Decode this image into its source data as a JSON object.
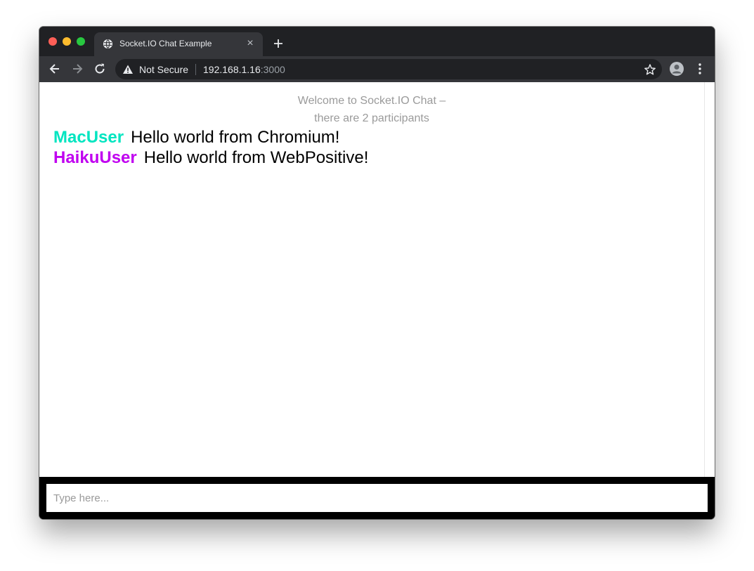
{
  "browser": {
    "tab": {
      "title": "Socket.IO Chat Example",
      "close_glyph": "×"
    },
    "omnibox": {
      "security_label": "Not Secure",
      "host": "192.168.1.16",
      "port": ":3000"
    },
    "colors": {
      "traffic_close": "#ff5f57",
      "traffic_minimize": "#febc2e",
      "traffic_zoom": "#28c840"
    },
    "icons": [
      "globe-icon",
      "close-icon",
      "plus-icon",
      "back-arrow-icon",
      "forward-arrow-icon",
      "reload-icon",
      "warning-icon",
      "star-icon",
      "profile-avatar-icon",
      "kebab-menu-icon"
    ]
  },
  "chat": {
    "welcome_line1": "Welcome to Socket.IO Chat –",
    "welcome_line2": "there are 2 participants",
    "messages": [
      {
        "username": "MacUser",
        "color": "#00e5c0",
        "body": "Hello world from Chromium!"
      },
      {
        "username": "HaikuUser",
        "color": "#c000f0",
        "body": "Hello world from WebPositive!"
      }
    ],
    "input": {
      "placeholder": "Type here...",
      "value": ""
    }
  }
}
